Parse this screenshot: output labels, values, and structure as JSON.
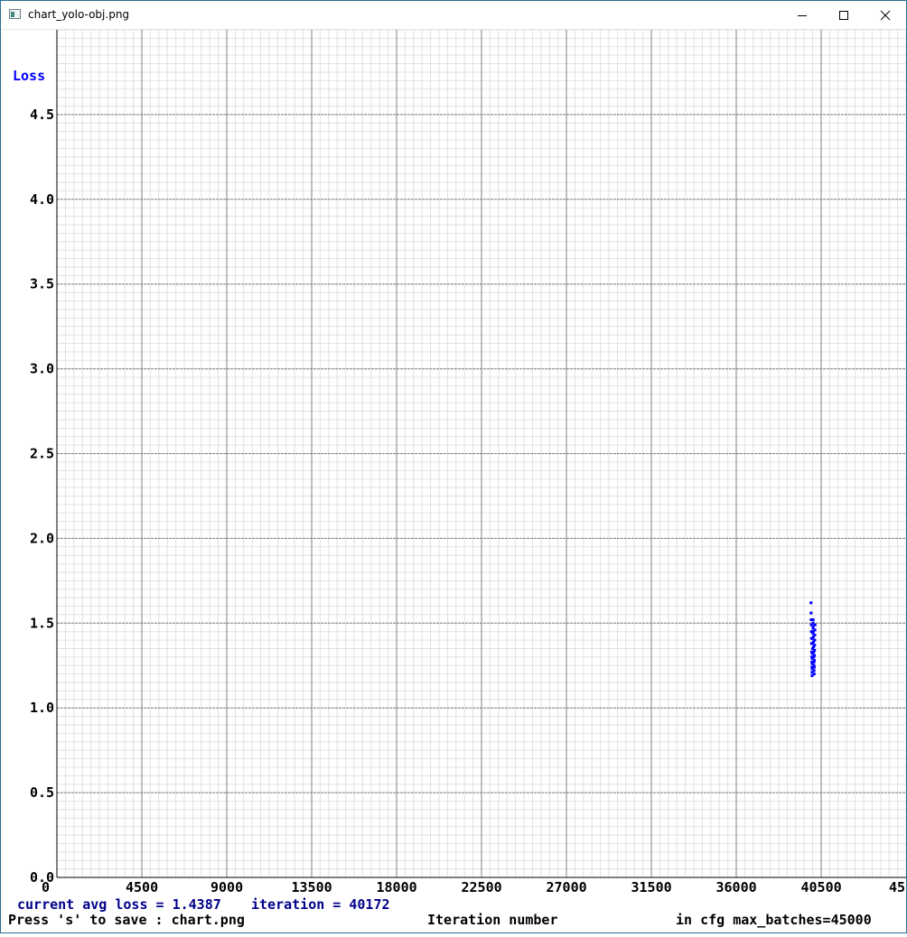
{
  "window": {
    "title": "chart_yolo-obj.png"
  },
  "icons": {
    "app": "image-icon",
    "minimize": "minimize-icon",
    "maximize": "maximize-icon",
    "close": "close-icon"
  },
  "chart_data": {
    "type": "scatter",
    "ylabel": "Loss",
    "xlabel": "Iteration number",
    "xlim": [
      0,
      45000
    ],
    "ylim": [
      0,
      5.0
    ],
    "x_ticks": [
      "0",
      "4500",
      "9000",
      "13500",
      "18000",
      "22500",
      "27000",
      "31500",
      "36000",
      "40500",
      "45"
    ],
    "y_ticks": [
      "0.0",
      "0.5",
      "1.0",
      "1.5",
      "2.0",
      "2.5",
      "3.0",
      "3.5",
      "4.0",
      "4.5"
    ],
    "grid": true,
    "series": [
      {
        "color": "#0000ff",
        "x": [
          39960,
          39965,
          39970,
          39975,
          39980,
          39985,
          39990,
          39995,
          40000,
          40005,
          40010,
          40015,
          40020,
          40025,
          40030,
          40035,
          40040,
          40045,
          40050,
          40055,
          40060,
          40065,
          40070,
          40075,
          40080,
          40085,
          40090,
          40095,
          40100,
          40105,
          40110,
          40115,
          40120,
          40125,
          40130,
          40135,
          40140,
          40145,
          40150,
          40155,
          40160,
          40165,
          40170,
          40175
        ],
        "y": [
          1.62,
          1.56,
          1.52,
          1.49,
          1.45,
          1.41,
          1.38,
          1.33,
          1.3,
          1.27,
          1.24,
          1.21,
          1.19,
          1.23,
          1.26,
          1.29,
          1.32,
          1.35,
          1.38,
          1.41,
          1.44,
          1.47,
          1.5,
          1.52,
          1.48,
          1.45,
          1.42,
          1.39,
          1.36,
          1.33,
          1.3,
          1.27,
          1.25,
          1.22,
          1.2,
          1.24,
          1.28,
          1.31,
          1.34,
          1.37,
          1.4,
          1.43,
          1.46,
          1.49
        ]
      }
    ]
  },
  "status": {
    "avg_loss_label": "current avg loss = 1.4387",
    "iteration_label": "iteration = 40172",
    "save_hint": "Press 's' to save : chart.png",
    "max_batches": "in cfg max_batches=45000"
  },
  "colors": {
    "axis_label": "#0000ff",
    "status_text": "#00008b",
    "grid_minor": "#e2e2e2",
    "grid_major": "#808080",
    "points": "#0000ff"
  }
}
